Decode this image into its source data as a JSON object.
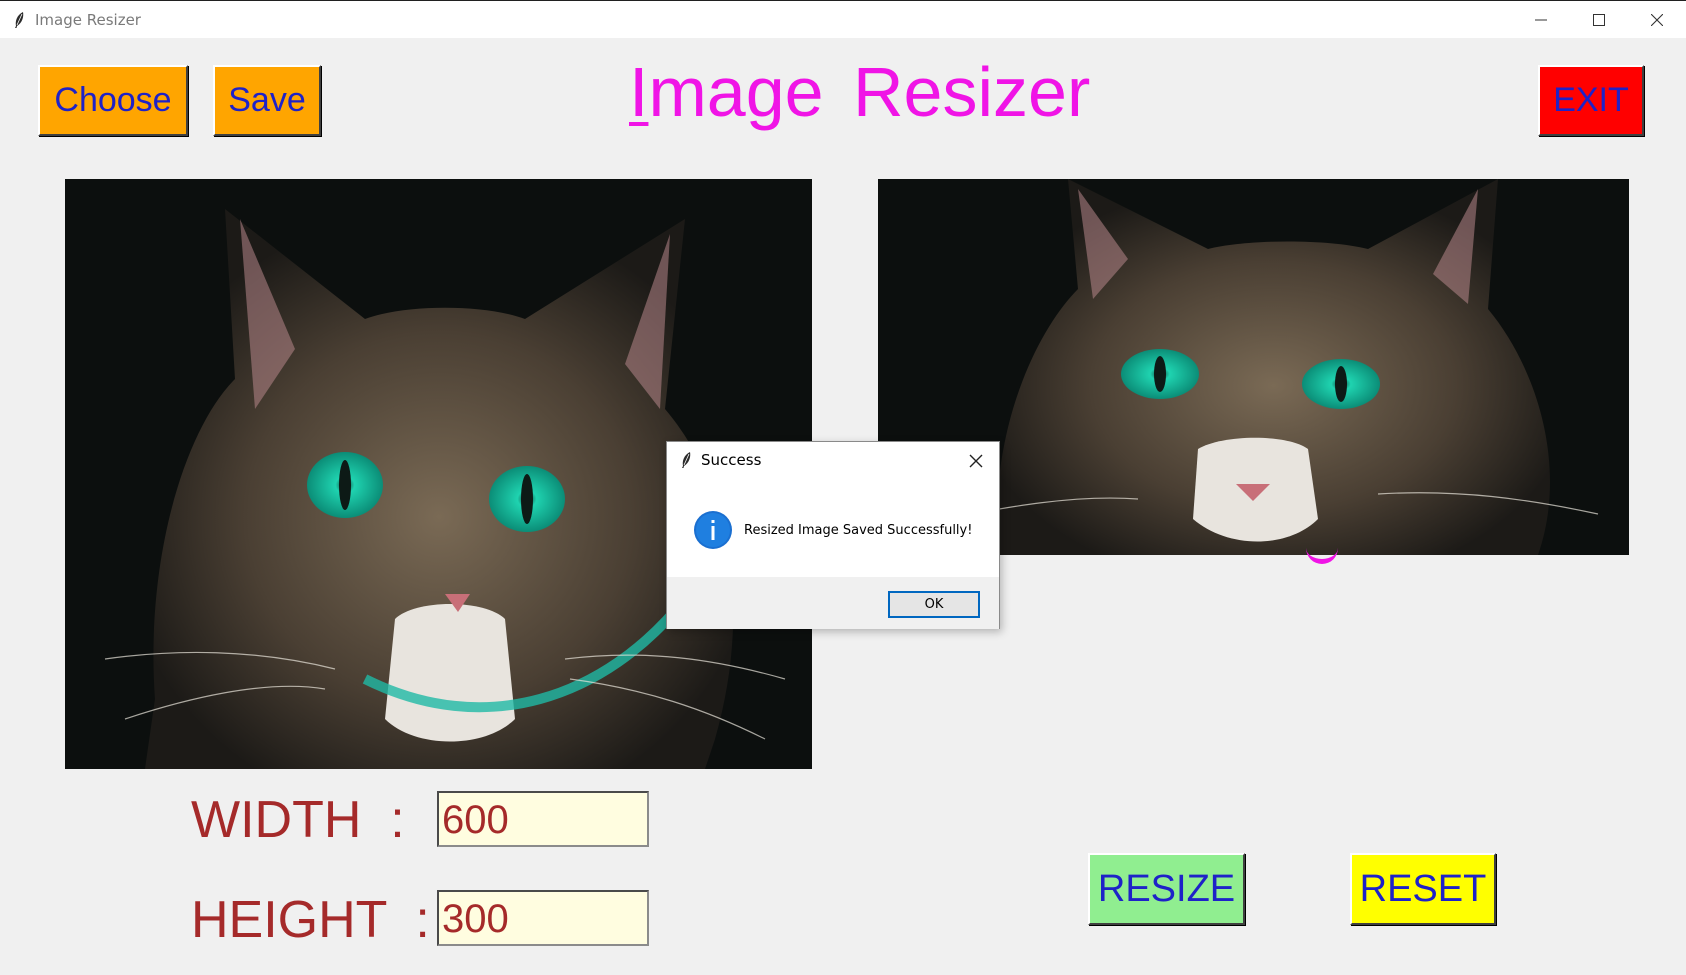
{
  "window": {
    "title": "Image Resizer"
  },
  "toolbar": {
    "choose_label": "Choose",
    "save_label": "Save",
    "exit_label": "EXIT"
  },
  "header": {
    "title_first_letter": "I",
    "title_rest": "mage  Resizer"
  },
  "form": {
    "width_label": "WIDTH  :",
    "width_value": "600",
    "height_label": "HEIGHT  :",
    "height_value": "300"
  },
  "actions": {
    "resize_label": "RESIZE",
    "reset_label": "RESET"
  },
  "dialog": {
    "title": "Success",
    "icon": "info-icon",
    "message": "Resized Image Saved Successfully!",
    "ok_label": "OK"
  },
  "colors": {
    "choose_save_bg": "#ffa500",
    "exit_bg": "#ff0000",
    "resize_bg": "#90ee90",
    "reset_bg": "#ffff00",
    "title_color": "#f014e6",
    "label_color": "#a52a2a",
    "button_text": "#1e22c8"
  }
}
